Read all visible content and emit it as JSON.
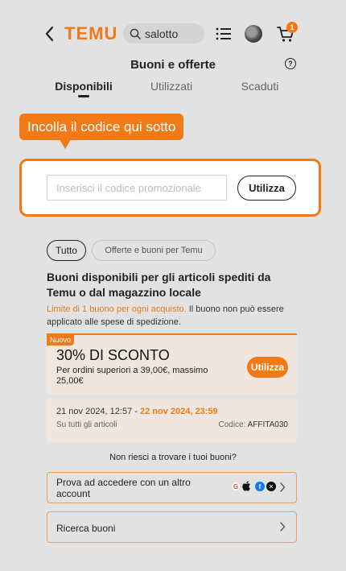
{
  "header": {
    "logo": "TEMU",
    "search_text": "salotto",
    "cart_count": "1"
  },
  "page": {
    "title": "Buoni e offerte",
    "tabs": [
      "Disponibili",
      "Utilizzati",
      "Scaduti"
    ],
    "active_tab": "Disponibili"
  },
  "tooltip": "Incolla il codice qui sotto",
  "promo": {
    "placeholder": "Inserisci il codice promozionale",
    "value": "",
    "button": "Utilizza"
  },
  "filters": [
    "Tutto",
    "Offerte e buoni per Temu"
  ],
  "section": {
    "heading": "Buoni disponibili per gli articoli spediti da Temu o dal magazzino locale",
    "note_highlight": "Limite di 1 buono per ogni acquisto.",
    "note_rest": " Il buono non può essere applicato alle spese di spedizione."
  },
  "coupon": {
    "badge": "Nuovo",
    "amount": "30% DI SCONTO",
    "condition": "Per ordini superiori a 39,00€, massimo 25,00€",
    "button": "Utilizza",
    "start": "21 nov 2024, 12:57 - ",
    "end": "22 nov 2024, 23:59",
    "scope": "Su tutti gli articoli",
    "code_label": "Codice: ",
    "code": "AFFITA030"
  },
  "footer": {
    "not_found": "Non riesci a trovare i tuoi buoni?",
    "login_row": "Prova ad accedere con un altro account",
    "search_row": "Ricerca buoni"
  },
  "colors": {
    "accent": "#f07a17",
    "background": "#e2e2e2"
  },
  "icons": [
    "back-icon",
    "search-icon",
    "list-icon",
    "cart-icon",
    "help-icon",
    "google-icon",
    "apple-icon",
    "facebook-icon",
    "x-icon",
    "chevron-right-icon"
  ]
}
